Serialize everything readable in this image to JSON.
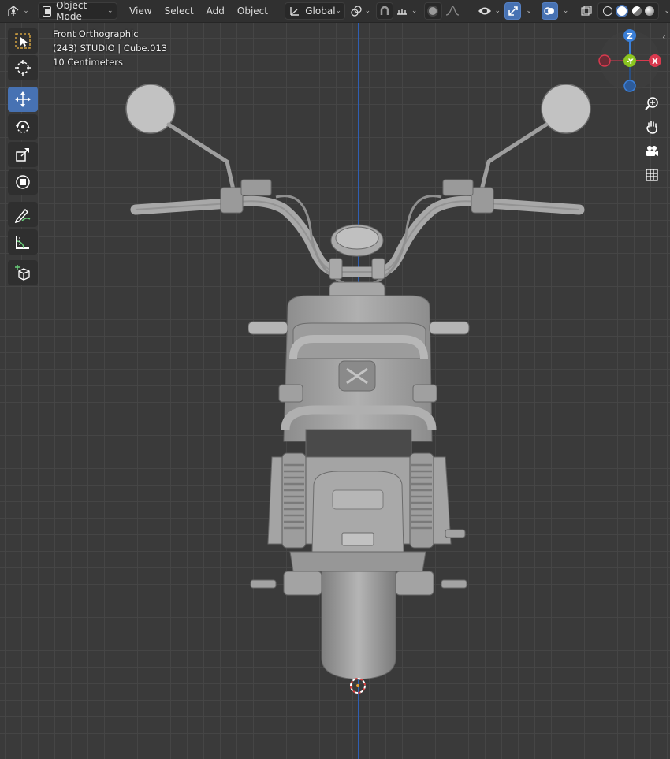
{
  "header": {
    "editor_type_icon": "viewport-editor-icon",
    "mode_label": "Object Mode",
    "menus": [
      "View",
      "Select",
      "Add",
      "Object"
    ],
    "orientation_label": "Global"
  },
  "overlay": {
    "view_name": "Front Orthographic",
    "object_info": "(243) STUDIO | Cube.013",
    "grid_scale": "10 Centimeters"
  },
  "gizmo": {
    "z_label": "Z",
    "y_label": "-Y",
    "x_label": "X"
  },
  "toolbar": {
    "tools": [
      "select-box",
      "cursor",
      "move",
      "rotate",
      "scale",
      "transform",
      "annotate",
      "measure",
      "add-cube"
    ],
    "active_tool": "move"
  },
  "colors": {
    "viewport_bg": "#3a3a3a",
    "grid_line": "#464646",
    "z_axis": "#2f5fb3",
    "x_axis": "#9a3a3a",
    "active": "#4772b3",
    "gizmo_x": "#d9394e",
    "gizmo_y": "#8bc520",
    "gizmo_z": "#3a7fd8"
  }
}
